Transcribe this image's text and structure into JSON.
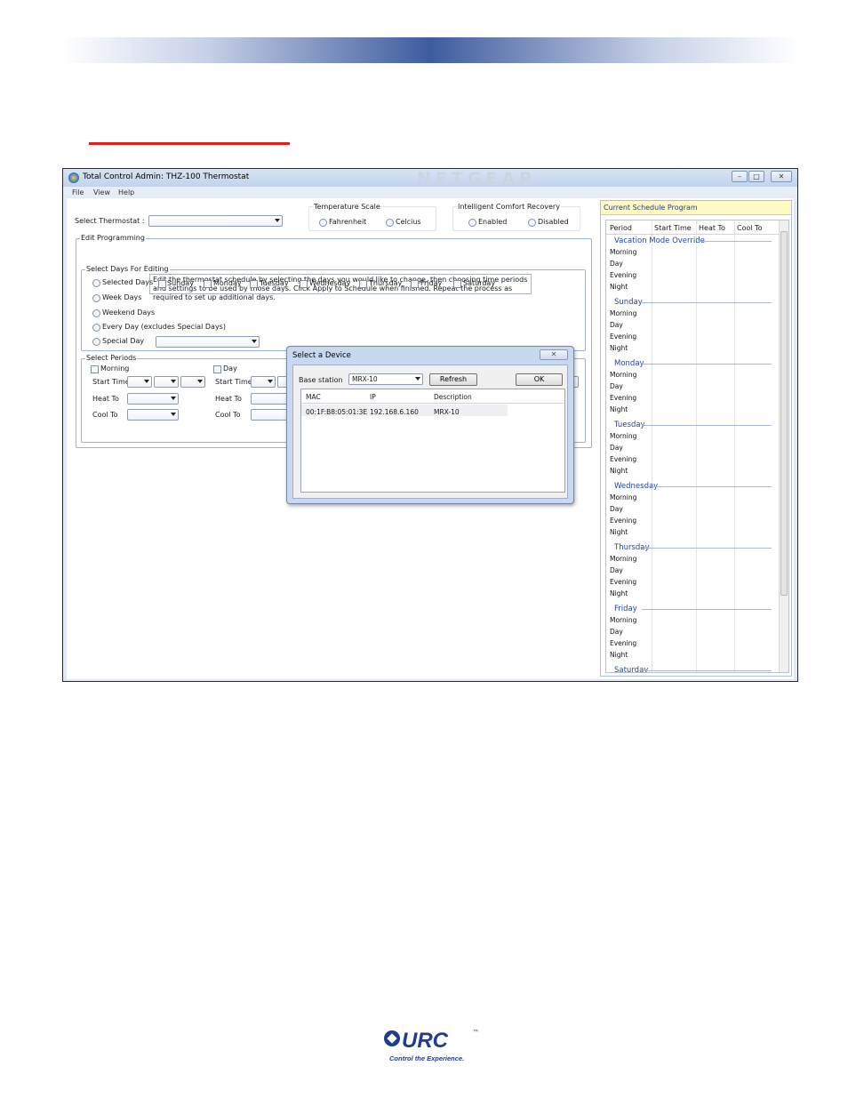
{
  "window": {
    "title": "Total Control Admin: THZ-100 Thermostat",
    "watermark": "NETGEAR",
    "controls": {
      "minimize": "–",
      "maximize": "□",
      "close": "✕"
    }
  },
  "menu": [
    "File",
    "View",
    "Help"
  ],
  "thermostat": {
    "label": "Select Thermostat :",
    "value": ""
  },
  "temperature_scale": {
    "title": "Temperature Scale",
    "options": [
      "Fahrenheit",
      "Celcius"
    ]
  },
  "comfort_recovery": {
    "title": "Intelligent Comfort Recovery",
    "options": [
      "Enabled",
      "Disabled"
    ]
  },
  "edit_programming": {
    "title": "Edit Programming",
    "instructions": "Edit the thermostat schedule by selecting the days you would like to change, then choosing time periods and settings to be used by those days.  Click Apply to Schedule when finished.  Repeat the process as required to set up additional days."
  },
  "select_days": {
    "title": "Select Days For Editing",
    "options": [
      "Selected Days",
      "Week Days",
      "Weekend Days",
      "Every Day (excludes Special Days)",
      "Special Day"
    ],
    "days": [
      "Sunday",
      "Monday",
      "Tuesday",
      "Wednesday",
      "Thursday",
      "Friday",
      "Saturday"
    ]
  },
  "select_periods": {
    "title": "Select Periods",
    "periods": [
      "Morning",
      "Day"
    ],
    "fields": [
      "Start Time",
      "Heat To",
      "Cool To"
    ]
  },
  "schedule": {
    "title": "Current Schedule Program",
    "columns": [
      "Period",
      "Start Time",
      "Heat To",
      "Cool To"
    ],
    "sections": [
      "Vacation Mode Override",
      "Sunday",
      "Monday",
      "Tuesday",
      "Wednesday",
      "Thursday",
      "Friday",
      "Saturday"
    ],
    "rows": [
      "Morning",
      "Day",
      "Evening",
      "Night"
    ]
  },
  "dialog": {
    "title": "Select a Device",
    "close": "✕",
    "base_station_label": "Base station",
    "base_station_value": "MRX-10",
    "refresh": "Refresh",
    "ok": "OK",
    "columns": [
      "MAC",
      "IP",
      "Description"
    ],
    "devices": [
      {
        "mac": "00:1F:B8:05:01:3E",
        "ip": "192.168.6.160",
        "description": "MRX-10"
      }
    ]
  },
  "footer": {
    "brand": "URC",
    "trademark": "™",
    "tagline": "Control the Experience."
  },
  "colors": {
    "accent": "#2046a7",
    "rule": "#e41b17",
    "banner": "#3e5c9e"
  }
}
